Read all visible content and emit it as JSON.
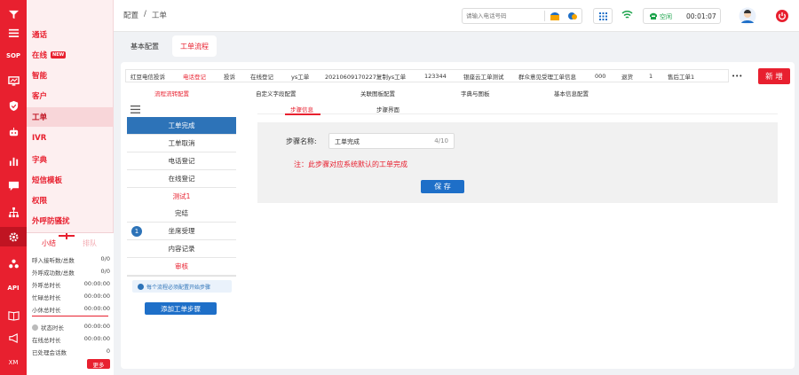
{
  "rail": {
    "items": [
      "menu-icon",
      "funnel-icon",
      "SOP",
      "chart-monitor-icon",
      "shield-icon",
      "robot-icon",
      "bar-chart-icon",
      "chat-icon",
      "org-icon",
      "gear-icon",
      "users-icon",
      "API",
      "book-icon",
      "megaphone-icon",
      "XM"
    ]
  },
  "menu": {
    "items": [
      {
        "label": "通话"
      },
      {
        "label": "在线",
        "badge": "NEW"
      },
      {
        "label": "智能"
      },
      {
        "label": "客户"
      },
      {
        "label": "工单"
      },
      {
        "label": "IVR"
      },
      {
        "label": "字典"
      },
      {
        "label": "短信模板"
      },
      {
        "label": "权限"
      },
      {
        "label": "外呼防骚扰"
      }
    ],
    "tabs": [
      "小结",
      "排队"
    ],
    "stats": [
      {
        "label": "呼入接听数/总数",
        "value": "0/0"
      },
      {
        "label": "外呼成功数/总数",
        "value": "0/0"
      },
      {
        "label": "外呼总时长",
        "value": "00:00:00"
      },
      {
        "label": "忙碌总时长",
        "value": "00:00:00"
      },
      {
        "label": "小休总时长",
        "value": "00:00:00"
      }
    ],
    "status_stats": [
      {
        "label": "状态时长",
        "value": "00:00:00"
      },
      {
        "label": "在线总时长",
        "value": "00:00:00"
      },
      {
        "label": "已处理会话数",
        "value": "0"
      }
    ],
    "more": "更多"
  },
  "topbar": {
    "breadcrumb_1": "配置",
    "breadcrumb_sep": "/",
    "breadcrumb_2": "工单",
    "phone_placeholder": "请输入电话号码",
    "status": "空闲",
    "timer": "00:01:07"
  },
  "page_tabs": [
    "基本配置",
    "工单流程"
  ],
  "order_tabs": [
    "红豆电信投诉",
    "电话登记",
    "投诉",
    "在线登记",
    "ys工单",
    "20210609170227复制ys工单",
    "123344",
    "银座云工单测试",
    "群众意见受理工单信息",
    "000",
    "退货",
    "1",
    "售后工单1"
  ],
  "more_dots": "•••",
  "new_button": "新 增",
  "sub_tabs": [
    "流程流转配置",
    "自定义字段配置",
    "关联图板配置",
    "字典与图板",
    "基本信息配置"
  ],
  "step_tabs": [
    "步骤信息",
    "步骤界面"
  ],
  "steps": [
    "工单完成",
    "工单取消",
    "电话登记",
    "在线登记",
    "测试1",
    "完结",
    "坐席受理",
    "内容记录",
    "审核"
  ],
  "step_badge": "1",
  "hint": "每个流程必须配置开始步骤",
  "add_step_button": "添加工单步骤",
  "form": {
    "name_label": "步骤名称:",
    "name_value": "工单完成",
    "name_count": "4/10",
    "note": "注：此步骤对应系统默认的工单完成",
    "save_button": "保 存"
  },
  "colors": {
    "brand": "#e8202f",
    "blue": "#1e6fc8",
    "green": "#1aa34a"
  }
}
